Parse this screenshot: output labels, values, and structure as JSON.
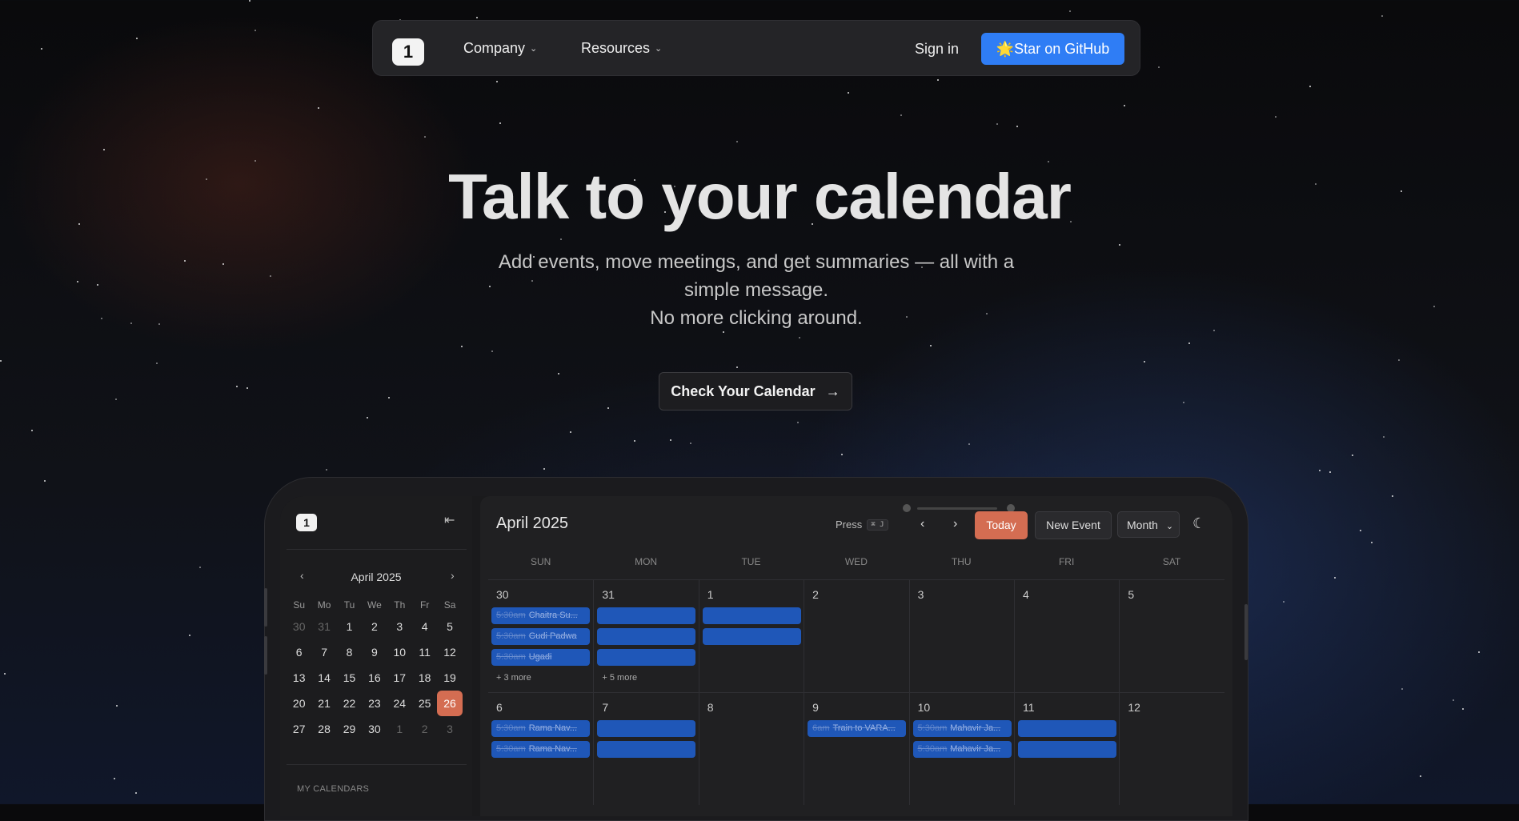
{
  "nav": {
    "logo": "1",
    "company": "Company",
    "resources": "Resources",
    "signin": "Sign in",
    "github": "🌟Star on GitHub"
  },
  "hero": {
    "title": "Talk to your calendar",
    "sub1": "Add events, move meetings, and get summaries — all with a simple message.",
    "sub2": "No more clicking around.",
    "cta": "Check Your Calendar"
  },
  "app": {
    "sidebar": {
      "logo": "1",
      "month": "April 2025",
      "dow": [
        "Su",
        "Mo",
        "Tu",
        "We",
        "Th",
        "Fr",
        "Sa"
      ],
      "days": [
        [
          "30",
          "muted"
        ],
        [
          "31",
          "muted"
        ],
        [
          "1",
          ""
        ],
        [
          "2",
          ""
        ],
        [
          "3",
          ""
        ],
        [
          "4",
          ""
        ],
        [
          "5",
          ""
        ],
        [
          "6",
          ""
        ],
        [
          "7",
          ""
        ],
        [
          "8",
          ""
        ],
        [
          "9",
          ""
        ],
        [
          "10",
          ""
        ],
        [
          "11",
          ""
        ],
        [
          "12",
          ""
        ],
        [
          "13",
          ""
        ],
        [
          "14",
          ""
        ],
        [
          "15",
          ""
        ],
        [
          "16",
          ""
        ],
        [
          "17",
          ""
        ],
        [
          "18",
          ""
        ],
        [
          "19",
          ""
        ],
        [
          "20",
          ""
        ],
        [
          "21",
          ""
        ],
        [
          "22",
          ""
        ],
        [
          "23",
          ""
        ],
        [
          "24",
          ""
        ],
        [
          "25",
          ""
        ],
        [
          "26",
          "sel"
        ],
        [
          "27",
          ""
        ],
        [
          "28",
          ""
        ],
        [
          "29",
          ""
        ],
        [
          "30",
          ""
        ],
        [
          "1",
          "muted"
        ],
        [
          "2",
          "muted"
        ],
        [
          "3",
          "muted"
        ]
      ],
      "my_calendars": "MY CALENDARS"
    },
    "header": {
      "title": "April 2025",
      "press": "Press",
      "kbd": "⌘ J",
      "today": "Today",
      "new_event": "New Event",
      "view": "Month"
    },
    "dow": [
      "SUN",
      "MON",
      "TUE",
      "WED",
      "THU",
      "FRI",
      "SAT"
    ],
    "cells": [
      {
        "num": "30",
        "events": [
          {
            "time": "5:30am",
            "name": "Chaitra Su..."
          },
          {
            "time": "5:30am",
            "name": "Gudi Padwa"
          },
          {
            "time": "5:30am",
            "name": "Ugadi"
          }
        ],
        "more": "+ 3 more"
      },
      {
        "num": "31",
        "events": [
          {
            "time": "",
            "name": ""
          },
          {
            "time": "",
            "name": ""
          },
          {
            "time": "",
            "name": ""
          }
        ],
        "more": "+ 5 more"
      },
      {
        "num": "1",
        "events": [
          {
            "time": "",
            "name": ""
          },
          {
            "time": "",
            "name": ""
          }
        ],
        "more": ""
      },
      {
        "num": "2",
        "events": [],
        "more": ""
      },
      {
        "num": "3",
        "events": [],
        "more": ""
      },
      {
        "num": "4",
        "events": [],
        "more": ""
      },
      {
        "num": "5",
        "events": [],
        "more": ""
      },
      {
        "num": "6",
        "events": [
          {
            "time": "5:30am",
            "name": "Rama Nav..."
          },
          {
            "time": "5:30am",
            "name": "Rama Nav..."
          }
        ],
        "more": ""
      },
      {
        "num": "7",
        "events": [
          {
            "time": "",
            "name": ""
          },
          {
            "time": "",
            "name": ""
          }
        ],
        "more": ""
      },
      {
        "num": "8",
        "events": [],
        "more": ""
      },
      {
        "num": "9",
        "events": [
          {
            "time": "6am",
            "name": "Train to VARA..."
          }
        ],
        "more": ""
      },
      {
        "num": "10",
        "events": [
          {
            "time": "5:30am",
            "name": "Mahavir Ja..."
          },
          {
            "time": "5:30am",
            "name": "Mahavir Ja..."
          }
        ],
        "more": ""
      },
      {
        "num": "11",
        "events": [
          {
            "time": "",
            "name": ""
          },
          {
            "time": "",
            "name": ""
          }
        ],
        "more": ""
      },
      {
        "num": "12",
        "events": [],
        "more": ""
      }
    ]
  }
}
